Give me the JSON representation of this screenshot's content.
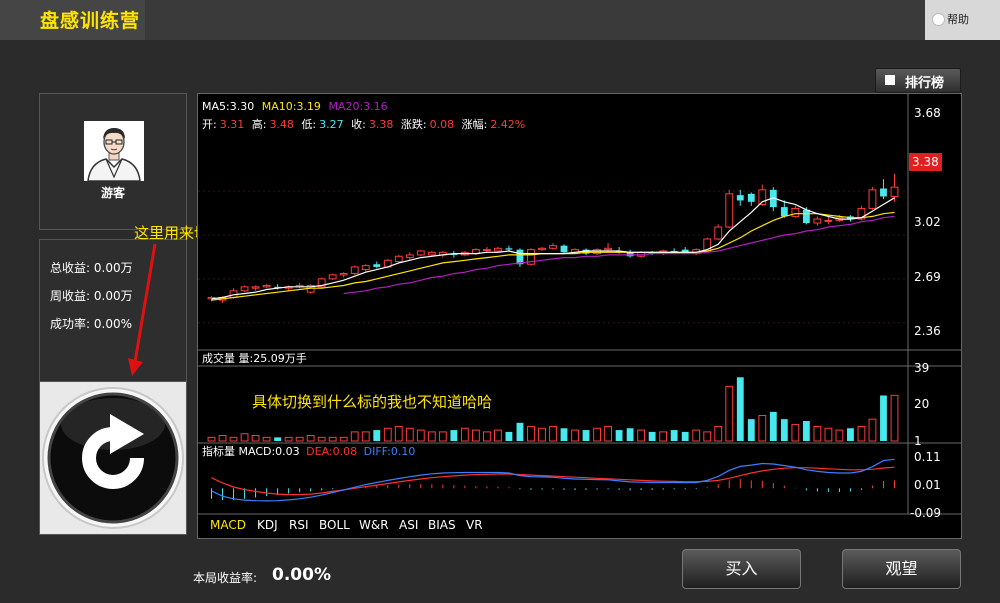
{
  "header": {
    "app_title": "盘感训练营",
    "help_label": "帮助"
  },
  "rank_button": {
    "label": "排行榜"
  },
  "user": {
    "name": "游客"
  },
  "stats": [
    {
      "label": "总收益:",
      "value": "0.00万"
    },
    {
      "label": "周收益:",
      "value": "0.00万"
    },
    {
      "label": "成功率:",
      "value": "0.00%"
    }
  ],
  "annotations": {
    "switch_hint": "这里用来切换到其他股票",
    "detail_hint": "具体切换到什么标的我也不知道哈哈"
  },
  "chart": {
    "ma_line": [
      {
        "label": "MA5:3.30",
        "color": "#ffffff"
      },
      {
        "label": "MA10:3.19",
        "color": "#ffe400"
      },
      {
        "label": "MA20:3.16",
        "color": "#b020c0"
      }
    ],
    "quote_line": [
      {
        "label": "开:",
        "value": "3.31"
      },
      {
        "label": "高:",
        "value": "3.48"
      },
      {
        "label": "低:",
        "value": "3.27"
      },
      {
        "label": "收:",
        "value": "3.38"
      },
      {
        "label": "涨跌:",
        "value": "0.08"
      },
      {
        "label": "涨幅:",
        "value": "2.42%"
      }
    ],
    "price_ticks": [
      "3.68",
      "3.02",
      "2.69",
      "2.36"
    ],
    "current_price": "3.38",
    "volume_header": "成交量 量:25.09万手",
    "volume_ticks": [
      "39",
      "20",
      "1"
    ],
    "macd_header": [
      {
        "label": "指标量 MACD:0.03",
        "color": "#ffffff"
      },
      {
        "label": "DEA:0.08",
        "color": "#ff3030"
      },
      {
        "label": "DIFF:0.10",
        "color": "#3a80ff"
      }
    ],
    "macd_ticks": [
      "0.11",
      "0.01",
      "-0.09"
    ],
    "indicator_tabs": [
      "MACD",
      "KDJ",
      "RSI",
      "BOLL",
      "W&R",
      "ASI",
      "BIAS",
      "VR"
    ],
    "active_tab": "MACD"
  },
  "chart_data": {
    "type": "candlestick",
    "ylim": [
      2.2,
      3.78
    ],
    "candles": [
      {
        "o": 2.54,
        "h": 2.56,
        "l": 2.52,
        "c": 2.55
      },
      {
        "o": 2.53,
        "h": 2.56,
        "l": 2.51,
        "c": 2.55
      },
      {
        "o": 2.55,
        "h": 2.62,
        "l": 2.54,
        "c": 2.6
      },
      {
        "o": 2.6,
        "h": 2.64,
        "l": 2.59,
        "c": 2.63
      },
      {
        "o": 2.62,
        "h": 2.64,
        "l": 2.6,
        "c": 2.63
      },
      {
        "o": 2.63,
        "h": 2.65,
        "l": 2.62,
        "c": 2.64
      },
      {
        "o": 2.63,
        "h": 2.65,
        "l": 2.61,
        "c": 2.62
      },
      {
        "o": 2.62,
        "h": 2.64,
        "l": 2.6,
        "c": 2.63
      },
      {
        "o": 2.63,
        "h": 2.66,
        "l": 2.62,
        "c": 2.64
      },
      {
        "o": 2.59,
        "h": 2.65,
        "l": 2.58,
        "c": 2.64
      },
      {
        "o": 2.63,
        "h": 2.7,
        "l": 2.62,
        "c": 2.69
      },
      {
        "o": 2.69,
        "h": 2.73,
        "l": 2.68,
        "c": 2.72
      },
      {
        "o": 2.72,
        "h": 2.74,
        "l": 2.7,
        "c": 2.73
      },
      {
        "o": 2.73,
        "h": 2.79,
        "l": 2.72,
        "c": 2.78
      },
      {
        "o": 2.76,
        "h": 2.8,
        "l": 2.74,
        "c": 2.79
      },
      {
        "o": 2.8,
        "h": 2.82,
        "l": 2.77,
        "c": 2.78
      },
      {
        "o": 2.78,
        "h": 2.84,
        "l": 2.77,
        "c": 2.83
      },
      {
        "o": 2.82,
        "h": 2.87,
        "l": 2.81,
        "c": 2.86
      },
      {
        "o": 2.85,
        "h": 2.89,
        "l": 2.83,
        "c": 2.87
      },
      {
        "o": 2.87,
        "h": 2.91,
        "l": 2.86,
        "c": 2.9
      },
      {
        "o": 2.87,
        "h": 2.9,
        "l": 2.86,
        "c": 2.89
      },
      {
        "o": 2.87,
        "h": 2.9,
        "l": 2.85,
        "c": 2.89
      },
      {
        "o": 2.88,
        "h": 2.9,
        "l": 2.85,
        "c": 2.87
      },
      {
        "o": 2.87,
        "h": 2.9,
        "l": 2.86,
        "c": 2.89
      },
      {
        "o": 2.88,
        "h": 2.92,
        "l": 2.87,
        "c": 2.91
      },
      {
        "o": 2.91,
        "h": 2.93,
        "l": 2.89,
        "c": 2.91
      },
      {
        "o": 2.9,
        "h": 2.93,
        "l": 2.89,
        "c": 2.92
      },
      {
        "o": 2.92,
        "h": 2.94,
        "l": 2.9,
        "c": 2.91
      },
      {
        "o": 2.91,
        "h": 2.92,
        "l": 2.78,
        "c": 2.8
      },
      {
        "o": 2.8,
        "h": 2.92,
        "l": 2.79,
        "c": 2.91
      },
      {
        "o": 2.91,
        "h": 2.93,
        "l": 2.9,
        "c": 2.92
      },
      {
        "o": 2.92,
        "h": 2.96,
        "l": 2.91,
        "c": 2.94
      },
      {
        "o": 2.94,
        "h": 2.95,
        "l": 2.88,
        "c": 2.89
      },
      {
        "o": 2.89,
        "h": 2.92,
        "l": 2.88,
        "c": 2.91
      },
      {
        "o": 2.91,
        "h": 2.92,
        "l": 2.87,
        "c": 2.88
      },
      {
        "o": 2.88,
        "h": 2.92,
        "l": 2.87,
        "c": 2.91
      },
      {
        "o": 2.91,
        "h": 2.96,
        "l": 2.9,
        "c": 2.92
      },
      {
        "o": 2.9,
        "h": 2.93,
        "l": 2.88,
        "c": 2.89
      },
      {
        "o": 2.89,
        "h": 2.91,
        "l": 2.85,
        "c": 2.86
      },
      {
        "o": 2.86,
        "h": 2.9,
        "l": 2.85,
        "c": 2.89
      },
      {
        "o": 2.89,
        "h": 2.9,
        "l": 2.87,
        "c": 2.88
      },
      {
        "o": 2.89,
        "h": 2.91,
        "l": 2.87,
        "c": 2.9
      },
      {
        "o": 2.9,
        "h": 2.92,
        "l": 2.88,
        "c": 2.89
      },
      {
        "o": 2.91,
        "h": 2.93,
        "l": 2.88,
        "c": 2.89
      },
      {
        "o": 2.88,
        "h": 2.92,
        "l": 2.87,
        "c": 2.91
      },
      {
        "o": 2.9,
        "h": 3.0,
        "l": 2.89,
        "c": 2.99
      },
      {
        "o": 2.99,
        "h": 3.1,
        "l": 2.98,
        "c": 3.08
      },
      {
        "o": 3.08,
        "h": 3.36,
        "l": 3.07,
        "c": 3.33
      },
      {
        "o": 3.32,
        "h": 3.36,
        "l": 3.24,
        "c": 3.28
      },
      {
        "o": 3.33,
        "h": 3.34,
        "l": 3.24,
        "c": 3.27
      },
      {
        "o": 3.25,
        "h": 3.4,
        "l": 3.24,
        "c": 3.36
      },
      {
        "o": 3.36,
        "h": 3.38,
        "l": 3.2,
        "c": 3.23
      },
      {
        "o": 3.23,
        "h": 3.28,
        "l": 3.15,
        "c": 3.16
      },
      {
        "o": 3.16,
        "h": 3.24,
        "l": 3.15,
        "c": 3.22
      },
      {
        "o": 3.21,
        "h": 3.23,
        "l": 3.1,
        "c": 3.11
      },
      {
        "o": 3.11,
        "h": 3.16,
        "l": 3.09,
        "c": 3.14
      },
      {
        "o": 3.13,
        "h": 3.16,
        "l": 3.1,
        "c": 3.13
      },
      {
        "o": 3.13,
        "h": 3.17,
        "l": 3.12,
        "c": 3.15
      },
      {
        "o": 3.16,
        "h": 3.17,
        "l": 3.12,
        "c": 3.14
      },
      {
        "o": 3.14,
        "h": 3.24,
        "l": 3.13,
        "c": 3.22
      },
      {
        "o": 3.22,
        "h": 3.38,
        "l": 3.21,
        "c": 3.36
      },
      {
        "o": 3.37,
        "h": 3.44,
        "l": 3.29,
        "c": 3.31
      },
      {
        "o": 3.31,
        "h": 3.48,
        "l": 3.27,
        "c": 3.38
      }
    ],
    "ma5": [
      2.54,
      2.55,
      2.57,
      2.58,
      2.59,
      2.61,
      2.62,
      2.63,
      2.63,
      2.63,
      2.64,
      2.66,
      2.68,
      2.71,
      2.74,
      2.76,
      2.78,
      2.81,
      2.83,
      2.85,
      2.86,
      2.87,
      2.88,
      2.88,
      2.88,
      2.89,
      2.89,
      2.9,
      2.88,
      2.88,
      2.88,
      2.88,
      2.88,
      2.89,
      2.9,
      2.9,
      2.9,
      2.9,
      2.89,
      2.89,
      2.89,
      2.89,
      2.89,
      2.89,
      2.89,
      2.91,
      2.95,
      3.05,
      3.12,
      3.19,
      3.27,
      3.3,
      3.27,
      3.25,
      3.21,
      3.18,
      3.16,
      3.14,
      3.14,
      3.15,
      3.2,
      3.25,
      3.3
    ],
    "ma10": [
      2.53,
      2.54,
      2.55,
      2.56,
      2.57,
      2.58,
      2.59,
      2.6,
      2.61,
      2.62,
      2.62,
      2.63,
      2.64,
      2.66,
      2.67,
      2.69,
      2.71,
      2.73,
      2.75,
      2.77,
      2.79,
      2.81,
      2.82,
      2.83,
      2.84,
      2.85,
      2.86,
      2.87,
      2.87,
      2.87,
      2.88,
      2.88,
      2.88,
      2.88,
      2.89,
      2.89,
      2.89,
      2.89,
      2.89,
      2.89,
      2.89,
      2.89,
      2.89,
      2.89,
      2.89,
      2.9,
      2.92,
      2.96,
      3.0,
      3.05,
      3.09,
      3.13,
      3.16,
      3.18,
      3.18,
      3.18,
      3.17,
      3.16,
      3.15,
      3.15,
      3.16,
      3.18,
      3.19
    ],
    "ma20": [
      null,
      null,
      null,
      null,
      null,
      null,
      null,
      null,
      null,
      null,
      null,
      null,
      2.58,
      2.59,
      2.6,
      2.62,
      2.63,
      2.65,
      2.66,
      2.68,
      2.7,
      2.71,
      2.73,
      2.74,
      2.76,
      2.77,
      2.79,
      2.8,
      2.81,
      2.82,
      2.83,
      2.84,
      2.85,
      2.85,
      2.86,
      2.86,
      2.87,
      2.87,
      2.87,
      2.87,
      2.88,
      2.88,
      2.88,
      2.88,
      2.88,
      2.89,
      2.9,
      2.92,
      2.94,
      2.96,
      2.98,
      3.0,
      3.02,
      3.03,
      3.05,
      3.06,
      3.08,
      3.09,
      3.1,
      3.12,
      3.13,
      3.15,
      3.16
    ],
    "volume_ylim": [
      0,
      39
    ],
    "volumes": [
      2,
      3,
      2,
      4,
      3,
      2,
      2,
      2,
      2,
      3,
      2,
      2,
      2,
      5,
      5,
      6,
      7,
      8,
      7,
      6,
      5,
      5,
      6,
      7,
      6,
      5,
      6,
      5,
      10,
      8,
      7,
      8,
      7,
      6,
      6,
      7,
      8,
      6,
      7,
      6,
      5,
      5,
      6,
      5,
      6,
      5,
      8,
      30,
      35,
      12,
      14,
      16,
      12,
      9,
      11,
      8,
      7,
      6,
      7,
      8,
      12,
      25,
      25.09
    ],
    "macd_ylim": [
      -0.09,
      0.13
    ],
    "macd_hist": [
      -0.04,
      -0.045,
      -0.045,
      -0.04,
      -0.035,
      -0.03,
      -0.025,
      -0.02,
      -0.015,
      -0.012,
      -0.008,
      -0.004,
      0.0,
      0.004,
      0.008,
      0.01,
      0.012,
      0.014,
      0.015,
      0.016,
      0.015,
      0.014,
      0.012,
      0.01,
      0.008,
      0.007,
      0.006,
      0.004,
      -0.004,
      -0.006,
      -0.005,
      -0.004,
      -0.006,
      -0.007,
      -0.006,
      -0.005,
      -0.004,
      -0.006,
      -0.008,
      -0.007,
      -0.006,
      -0.005,
      -0.004,
      -0.004,
      -0.003,
      0.004,
      0.015,
      0.03,
      0.035,
      0.03,
      0.028,
      0.02,
      0.01,
      0.002,
      -0.008,
      -0.012,
      -0.014,
      -0.014,
      -0.012,
      -0.006,
      0.01,
      0.028,
      0.03
    ],
    "dea": [
      0.04,
      0.02,
      0.005,
      -0.005,
      -0.012,
      -0.018,
      -0.022,
      -0.024,
      -0.024,
      -0.022,
      -0.018,
      -0.012,
      -0.006,
      0.0,
      0.006,
      0.012,
      0.018,
      0.024,
      0.03,
      0.035,
      0.04,
      0.044,
      0.047,
      0.05,
      0.052,
      0.053,
      0.054,
      0.054,
      0.052,
      0.05,
      0.048,
      0.046,
      0.044,
      0.042,
      0.04,
      0.038,
      0.036,
      0.034,
      0.032,
      0.03,
      0.028,
      0.027,
      0.026,
      0.025,
      0.025,
      0.026,
      0.03,
      0.038,
      0.048,
      0.058,
      0.066,
      0.072,
      0.076,
      0.078,
      0.078,
      0.076,
      0.074,
      0.072,
      0.07,
      0.07,
      0.072,
      0.077,
      0.08
    ],
    "diff": [
      -0.01,
      -0.03,
      -0.04,
      -0.045,
      -0.047,
      -0.048,
      -0.047,
      -0.044,
      -0.04,
      -0.034,
      -0.026,
      -0.016,
      -0.006,
      0.004,
      0.014,
      0.022,
      0.03,
      0.037,
      0.044,
      0.05,
      0.055,
      0.058,
      0.059,
      0.06,
      0.06,
      0.06,
      0.06,
      0.058,
      0.048,
      0.044,
      0.043,
      0.042,
      0.038,
      0.035,
      0.034,
      0.033,
      0.032,
      0.028,
      0.024,
      0.023,
      0.022,
      0.022,
      0.022,
      0.021,
      0.022,
      0.03,
      0.045,
      0.068,
      0.083,
      0.088,
      0.094,
      0.092,
      0.086,
      0.08,
      0.07,
      0.064,
      0.06,
      0.058,
      0.058,
      0.064,
      0.082,
      0.105,
      0.11
    ]
  },
  "footer": {
    "round_label": "本局收益率:",
    "round_value": "0.00%",
    "buy_label": "买入",
    "watch_label": "观望"
  }
}
